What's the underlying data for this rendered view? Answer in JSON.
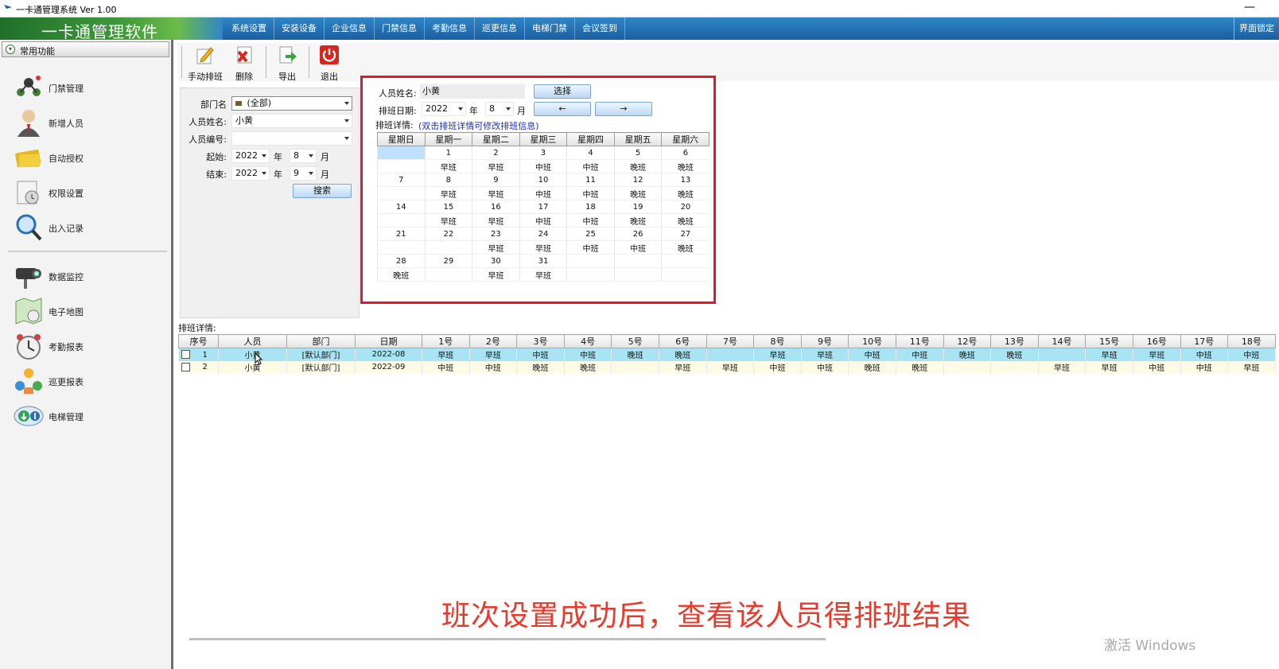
{
  "window": {
    "title": "一卡通管理系统  Ver 1.00",
    "minimize_glyph": "—"
  },
  "brand": "一卡通管理软件",
  "menu": [
    "系统设置",
    "安装设备",
    "企业信息",
    "门禁信息",
    "考勤信息",
    "巡更信息",
    "电梯门禁",
    "会议签到"
  ],
  "lock_label": "界面锁定",
  "sidebar": {
    "header": "常用功能",
    "items": [
      {
        "label": "门禁管理",
        "icon": "door-control-icon"
      },
      {
        "label": "新增人员",
        "icon": "user-add-icon"
      },
      {
        "label": "自动授权",
        "icon": "card-auth-icon"
      },
      {
        "label": "权限设置",
        "icon": "permission-icon"
      },
      {
        "label": "出入记录",
        "icon": "search-record-icon"
      },
      {
        "label": "数据监控",
        "icon": "camera-monitor-icon"
      },
      {
        "label": "电子地图",
        "icon": "map-icon"
      },
      {
        "label": "考勤报表",
        "icon": "attendance-clock-icon"
      },
      {
        "label": "巡更报表",
        "icon": "patrol-icon"
      },
      {
        "label": "电梯管理",
        "icon": "elevator-icon"
      }
    ]
  },
  "toolbar": {
    "manual": "手动排班",
    "delete": "删除",
    "export": "导出",
    "exit": "退出"
  },
  "filter": {
    "dept_label": "部门名",
    "dept_value": "(全部)",
    "name_label": "人员姓名:",
    "name_value": "小黄",
    "id_label": "人员编号:",
    "id_value": "",
    "start_label": "起始:",
    "start_year": "2022",
    "start_month": "8",
    "end_label": "结束:",
    "end_year": "2022",
    "end_month": "9",
    "year_unit": "年",
    "month_unit": "月",
    "search": "搜索"
  },
  "calendar": {
    "name_label": "人员姓名:",
    "name_value": "小黄",
    "select_btn": "选择",
    "date_label": "排班日期:",
    "year": "2022",
    "month": "8",
    "year_unit": "年",
    "month_unit": "月",
    "prev": "←",
    "next": "→",
    "detail_label": "排班详情:",
    "hint": "(双击排班详情可修改排班信息)",
    "weekdays": [
      "星期日",
      "星期一",
      "星期二",
      "星期三",
      "星期四",
      "星期五",
      "星期六"
    ],
    "rows": [
      [
        "",
        "1",
        "2",
        "3",
        "4",
        "5",
        "6"
      ],
      [
        "",
        "早班",
        "早班",
        "中班",
        "中班",
        "晚班",
        "晚班"
      ],
      [
        "7",
        "8",
        "9",
        "10",
        "11",
        "12",
        "13"
      ],
      [
        "",
        "早班",
        "早班",
        "中班",
        "中班",
        "晚班",
        "晚班"
      ],
      [
        "14",
        "15",
        "16",
        "17",
        "18",
        "19",
        "20"
      ],
      [
        "",
        "早班",
        "早班",
        "中班",
        "中班",
        "晚班",
        "晚班"
      ],
      [
        "21",
        "22",
        "23",
        "24",
        "25",
        "26",
        "27"
      ],
      [
        "",
        "",
        "早班",
        "早班",
        "中班",
        "中班",
        "晚班"
      ],
      [
        "28",
        "29",
        "30",
        "31",
        "",
        "",
        ""
      ],
      [
        "晚班",
        "",
        "早班",
        "早班",
        "",
        "",
        ""
      ]
    ]
  },
  "grid": {
    "caption": "排班详情:",
    "headers": [
      "序号",
      "人员",
      "部门",
      "日期",
      "1号",
      "2号",
      "3号",
      "4号",
      "5号",
      "6号",
      "7号",
      "8号",
      "9号",
      "10号",
      "11号",
      "12号",
      "13号",
      "14号",
      "15号",
      "16号",
      "17号",
      "18号"
    ],
    "rows": [
      [
        "1",
        "小黄",
        "[默认部门]",
        "2022-08",
        "早班",
        "早班",
        "中班",
        "中班",
        "晚班",
        "晚班",
        "",
        "早班",
        "早班",
        "中班",
        "中班",
        "晚班",
        "晚班",
        "",
        "早班",
        "早班",
        "中班",
        "中班"
      ],
      [
        "2",
        "小黄",
        "[默认部门]",
        "2022-09",
        "中班",
        "中班",
        "晚班",
        "晚班",
        "",
        "早班",
        "早班",
        "中班",
        "中班",
        "晚班",
        "晚班",
        "",
        "",
        "早班",
        "早班",
        "中班",
        "中班",
        "早班"
      ]
    ]
  },
  "subtitle": "班次设置成功后，查看该人员得排班结果",
  "watermark": "激活 Windows"
}
